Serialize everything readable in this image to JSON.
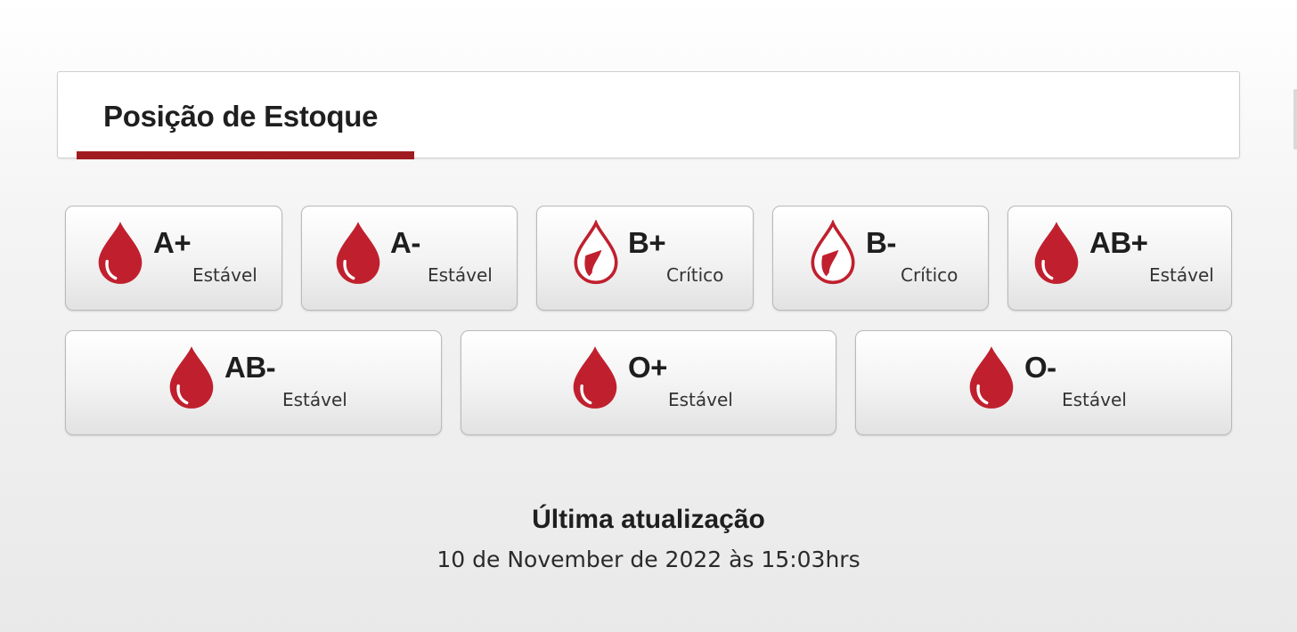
{
  "header": {
    "title": "Posição de Estoque"
  },
  "colors": {
    "accent": "#a01b20",
    "drop": "#c0202e"
  },
  "stock": [
    {
      "type": "A+",
      "status": "Estável",
      "icon": "blood-drop-full-icon"
    },
    {
      "type": "A-",
      "status": "Estável",
      "icon": "blood-drop-full-icon"
    },
    {
      "type": "B+",
      "status": "Crítico",
      "icon": "blood-drop-low-icon"
    },
    {
      "type": "B-",
      "status": "Crítico",
      "icon": "blood-drop-low-icon"
    },
    {
      "type": "AB+",
      "status": "Estável",
      "icon": "blood-drop-full-icon"
    },
    {
      "type": "AB-",
      "status": "Estável",
      "icon": "blood-drop-full-icon"
    },
    {
      "type": "O+",
      "status": "Estável",
      "icon": "blood-drop-full-icon"
    },
    {
      "type": "O-",
      "status": "Estável",
      "icon": "blood-drop-full-icon"
    }
  ],
  "footer": {
    "title": "Última atualização",
    "date": "10 de November de 2022 às 15:03hrs"
  }
}
